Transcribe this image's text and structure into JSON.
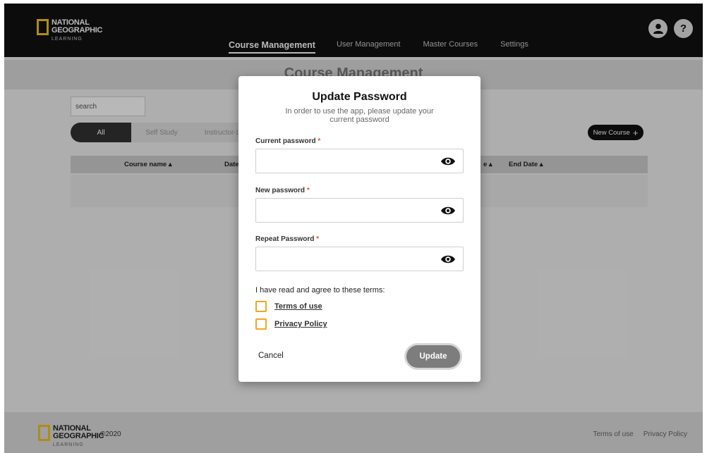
{
  "header": {
    "logo": {
      "line1": "NATIONAL",
      "line2": "GEOGRAPHIC",
      "line3": "LEARNING"
    },
    "nav": [
      "Course Management",
      "User Management",
      "Master Courses",
      "Settings"
    ],
    "help_label": "?"
  },
  "page": {
    "title": "Course Management",
    "search_placeholder": "search",
    "filters": [
      "All",
      "Self Study",
      "Instructor-L"
    ],
    "new_course_label": "New Course",
    "new_course_icon": "+",
    "table_headers": {
      "course_name": "Course name ▴",
      "date": "Date",
      "partial": "e ▴",
      "end_date": "End Date ▴"
    }
  },
  "footer": {
    "logo": {
      "line1": "NATIONAL",
      "line2": "GEOGRAPHIC",
      "line3": "LEARNING"
    },
    "copyright": "©2020",
    "links": [
      "Terms of use",
      "Privacy Policy"
    ]
  },
  "modal": {
    "title": "Update Password",
    "subtitle": "In order to use the app, please update your current password",
    "fields": [
      {
        "label": "Current password",
        "required": "*"
      },
      {
        "label": "New password",
        "required": "*"
      },
      {
        "label": "Repeat Password",
        "required": "*"
      }
    ],
    "terms_label": "I have read and agree to these terms:",
    "terms": [
      "Terms of use",
      "Privacy Policy"
    ],
    "cancel_label": "Cancel",
    "update_label": "Update"
  },
  "colors": {
    "header_bg": "#111111",
    "logo_yellow": "#f4c21b",
    "required": "#e0533a",
    "checkbox": "#f0a81f",
    "update_btn": "#7d7d7d"
  }
}
